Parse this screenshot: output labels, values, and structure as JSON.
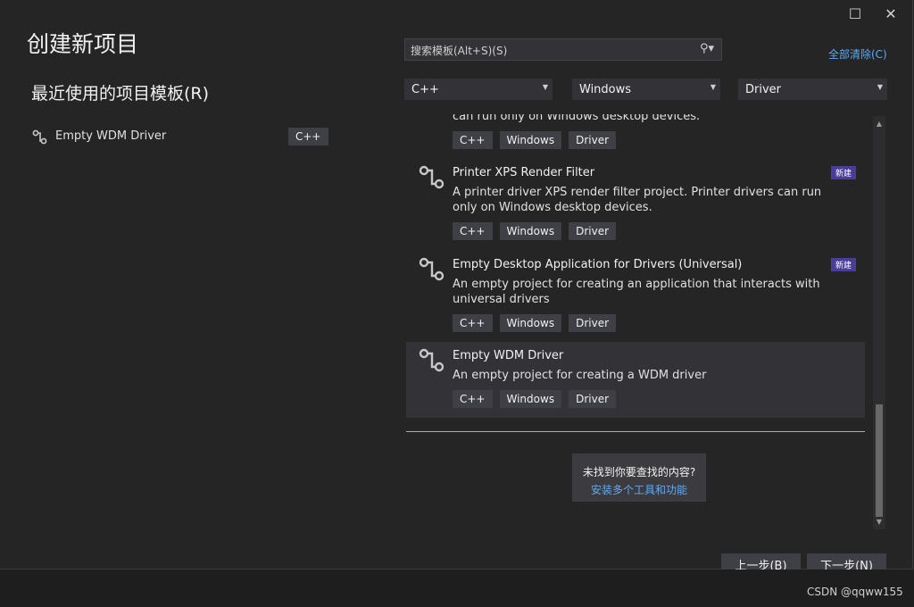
{
  "window": {
    "maximize_icon": "maximize-icon",
    "close_icon": "close-icon"
  },
  "page_title": "创建新项目",
  "recent": {
    "title": "最近使用的项目模板(R)",
    "items": [
      {
        "name": "Empty WDM Driver",
        "language": "C++",
        "icon": "driver-template-icon"
      }
    ]
  },
  "search": {
    "placeholder": "搜索模板(Alt+S)(S)",
    "icon": "search-icon"
  },
  "clear_all": "全部清除(C)",
  "filters": {
    "language": "C++",
    "platform": "Windows",
    "project_type": "Driver"
  },
  "templates": [
    {
      "name": "",
      "description": "can run only on Windows desktop devices.",
      "tags": [
        "C++",
        "Windows",
        "Driver"
      ],
      "badge": ""
    },
    {
      "name": "Printer XPS Render Filter",
      "description": "A printer driver XPS render filter project. Printer drivers can run only on Windows desktop devices.",
      "tags": [
        "C++",
        "Windows",
        "Driver"
      ],
      "badge": "新建"
    },
    {
      "name": "Empty Desktop Application for Drivers (Universal)",
      "description": "An empty project for creating an application that interacts with universal drivers",
      "tags": [
        "C++",
        "Windows",
        "Driver"
      ],
      "badge": "新建"
    },
    {
      "name": "Empty WDM Driver",
      "description": "An empty project for creating a WDM driver",
      "tags": [
        "C++",
        "Windows",
        "Driver"
      ],
      "badge": "",
      "selected": true
    }
  ],
  "not_found": {
    "question": "未找到你要查找的内容?",
    "link": "安装多个工具和功能"
  },
  "buttons": {
    "back": "上一步(B)",
    "next": "下一步(N)"
  },
  "watermark": "CSDN @qqww155",
  "colors": {
    "background": "#252526",
    "link": "#5fa9f3",
    "badge": "#4a3d99",
    "tag": "#3f3f46"
  }
}
